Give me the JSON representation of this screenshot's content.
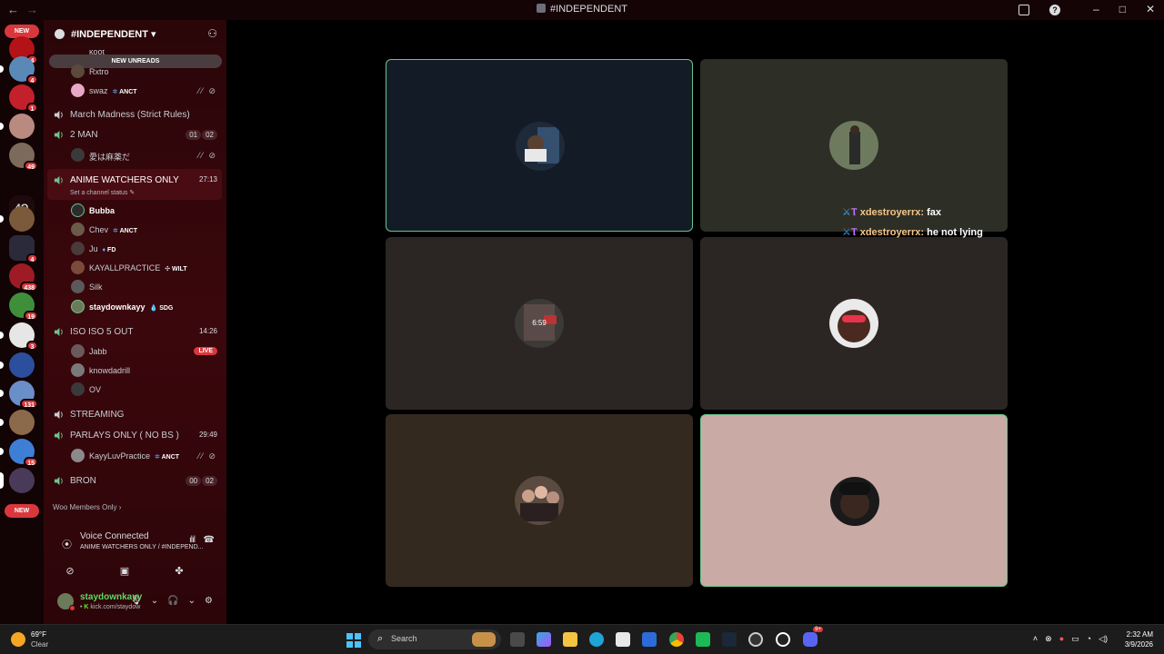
{
  "window": {
    "title": "#INDEPENDENT",
    "back": "←",
    "forward": "→"
  },
  "guild_badges": {
    "new_top": "NEW",
    "new_bottom": "NEW",
    "b1": "4",
    "b2": "4",
    "b3": "1",
    "b4": "49",
    "b5": "4",
    "b6": "438",
    "b7": "19",
    "b8": "3",
    "b9": "131",
    "b10": "15",
    "text_guild": "4Q"
  },
  "server": {
    "name": "#INDEPENDENT",
    "new_unreads": "NEW UNREADS"
  },
  "channels": [
    {
      "name": "March Madness (Strict Rules)"
    },
    {
      "name": "2 MAN",
      "count_a": "01",
      "count_b": "02"
    },
    {
      "name": "ANIME WATCHERS ONLY",
      "timer": "27:13",
      "status": "Set a channel status"
    },
    {
      "name": "ISO ISO 5 OUT",
      "timer": "14:26"
    },
    {
      "name": "STREAMING"
    },
    {
      "name": "PARLAYS ONLY ( NO BS )",
      "timer": "29:49"
    },
    {
      "name": "BRON",
      "count_a": "00",
      "count_b": "02"
    }
  ],
  "users": {
    "koot": "koot",
    "rxtro": "Rxtro",
    "swaz": "swaz",
    "swaz_tag": "ANCT",
    "aihamayaku": "愛は麻薬だ",
    "bubba": "Bubba",
    "chev": "Chev",
    "chev_tag": "ANCT",
    "ju": "Ju",
    "ju_tag": "FD",
    "kayall": "KAYALLPRACTICE",
    "kayall_tag": "WILT",
    "silk": "Silk",
    "staydown": "staydownkayy",
    "staydown_tag": "SDG",
    "jabb": "Jabb",
    "jabb_live": "LIVE",
    "knowdadrill": "knowdadrill",
    "ov": "OV",
    "kayyluv": "KayyLuvPractice",
    "kayyluv_tag": "ANCT"
  },
  "members_only": "Woo Members Only",
  "voice": {
    "connected": "Voice Connected",
    "location": "ANIME WATCHERS ONLY / #INDEPEND..."
  },
  "me": {
    "name": "staydownkayy",
    "status": "kick.com/staydow"
  },
  "tiles": {
    "clock": "6:59"
  },
  "chat": [
    {
      "user": "xdestroyerrx:",
      "text": "fax"
    },
    {
      "user": "xdestroyerrx:",
      "text": "he not lying"
    }
  ],
  "taskbar": {
    "temp": "69°F",
    "condition": "Clear",
    "search_label": "Search",
    "time": "2:32 AM",
    "date": "3/9/2026",
    "discord_badge": "9+"
  },
  "colors": {
    "accent_green": "#6cc48d",
    "badge_red": "#da373c",
    "sidebar_red": "#3a070c"
  }
}
